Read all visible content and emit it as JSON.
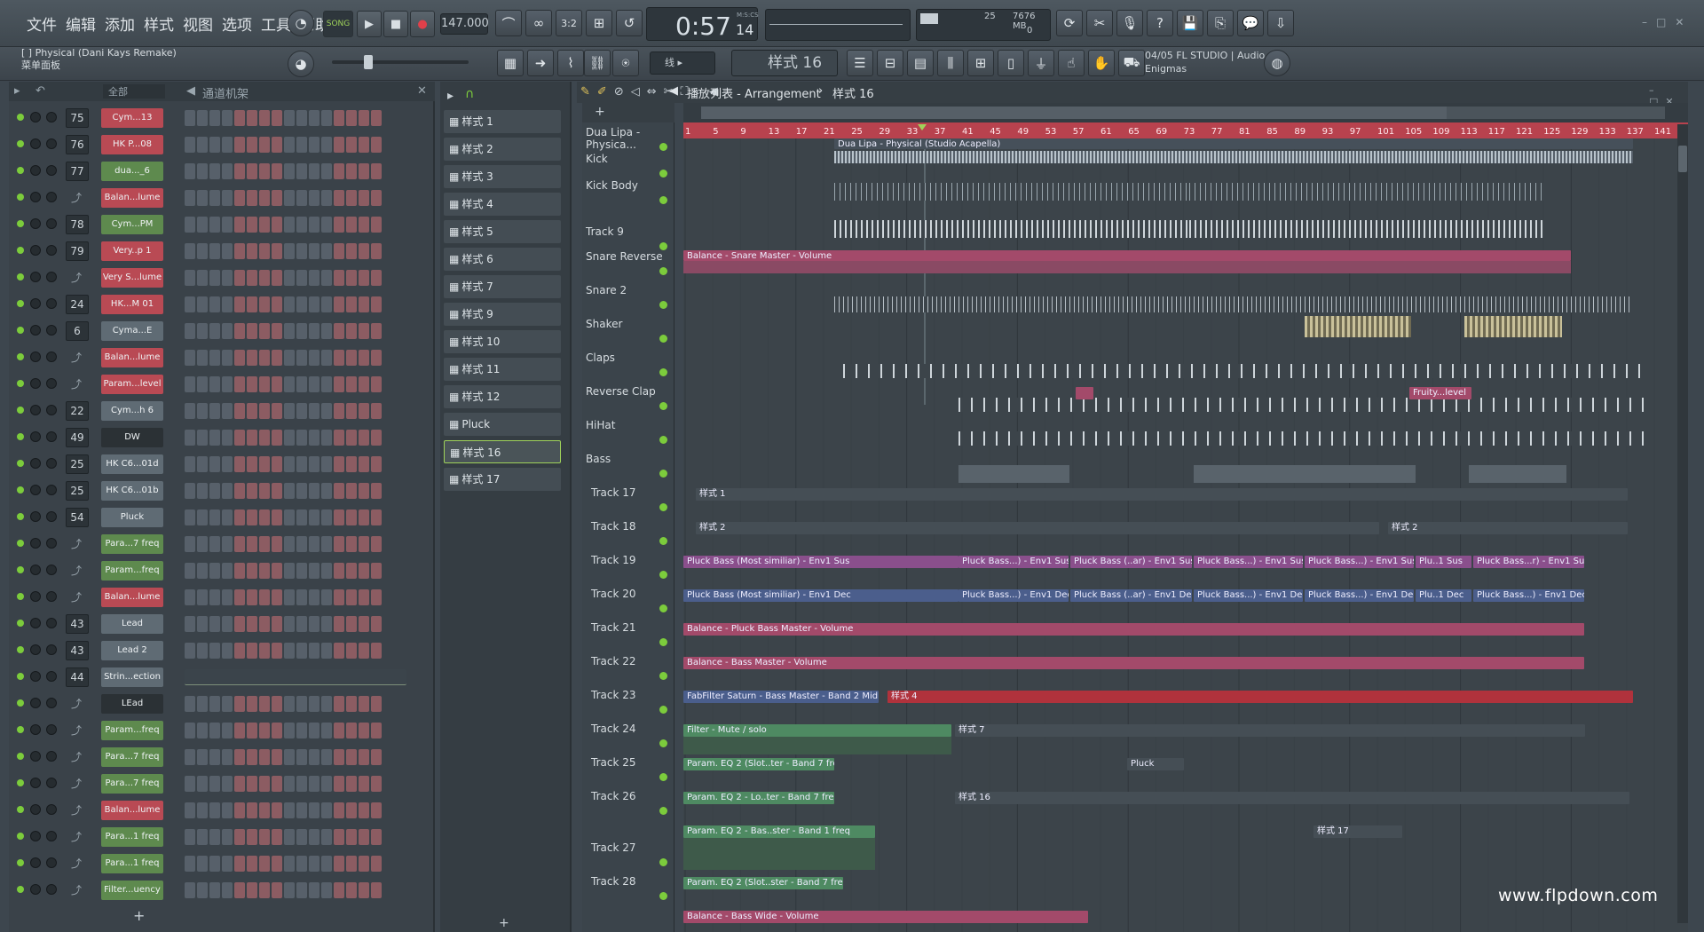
{
  "menu": [
    "文件",
    "编辑",
    "添加",
    "样式",
    "视图",
    "选项",
    "工具",
    "帮助"
  ],
  "hint": {
    "line1": "[  ] Physical (Dani Kays Remake)",
    "line2": "菜单面板"
  },
  "transport": {
    "mode": "SONG",
    "tempo": "147.000",
    "time": "0:57",
    "time_sub": "14",
    "time_unit": "M:S:CS"
  },
  "meters": {
    "cpu": "25",
    "mem": "7676 MB",
    "poly": "0"
  },
  "pattern_selector": {
    "value": "样式 16",
    "snap": "线"
  },
  "info": {
    "line1": "04/05  FL STUDIO | Audio",
    "line2": "Enigmas"
  },
  "rack": {
    "filter": "全部",
    "title": "通道机架"
  },
  "channels": [
    {
      "num": "75",
      "name": "Cym...13",
      "color": "#b94a54"
    },
    {
      "num": "76",
      "name": "HK P...08",
      "color": "#b94a54"
    },
    {
      "num": "77",
      "name": "dua..._6",
      "color": "#5e8a4e"
    },
    {
      "num": "",
      "name": "Balan...lume",
      "color": "#b94a54"
    },
    {
      "num": "78",
      "name": "Cym...PM",
      "color": "#5e8a4e"
    },
    {
      "num": "79",
      "name": "Very..p 1",
      "color": "#b94a54"
    },
    {
      "num": "",
      "name": "Very S...lume",
      "color": "#b94a54"
    },
    {
      "num": "24",
      "name": "HK...M 01",
      "color": "#b94a54"
    },
    {
      "num": "6",
      "name": "Cyma...E",
      "color": "#5f6b74"
    },
    {
      "num": "",
      "name": "Balan...lume",
      "color": "#b94a54"
    },
    {
      "num": "",
      "name": "Param...level",
      "color": "#b94a54"
    },
    {
      "num": "22",
      "name": "Cym...h 6",
      "color": "#5f6b74"
    },
    {
      "num": "49",
      "name": "DW",
      "color": "#2b3135"
    },
    {
      "num": "25",
      "name": "HK C6...01d",
      "color": "#5f6b74"
    },
    {
      "num": "25",
      "name": "HK C6...01b",
      "color": "#5f6b74"
    },
    {
      "num": "54",
      "name": "Pluck",
      "color": "#5f6b74"
    },
    {
      "num": "",
      "name": "Para...7 freq",
      "color": "#5e8a4e"
    },
    {
      "num": "",
      "name": "Param...freq",
      "color": "#5e8a4e"
    },
    {
      "num": "",
      "name": "Balan...lume",
      "color": "#b94a54"
    },
    {
      "num": "43",
      "name": "Lead",
      "color": "#5f6b74"
    },
    {
      "num": "43",
      "name": "Lead 2",
      "color": "#5f6b74"
    },
    {
      "num": "44",
      "name": "Strin...ection",
      "color": "#5f6b74"
    },
    {
      "num": "",
      "name": "LEad",
      "color": "#2b3135"
    },
    {
      "num": "",
      "name": "Param...freq",
      "color": "#5e8a4e"
    },
    {
      "num": "",
      "name": "Para...7 freq",
      "color": "#5e8a4e"
    },
    {
      "num": "",
      "name": "Para...7 freq",
      "color": "#5e8a4e"
    },
    {
      "num": "",
      "name": "Balan...lume",
      "color": "#b94a54"
    },
    {
      "num": "",
      "name": "Para...1 freq",
      "color": "#5e8a4e"
    },
    {
      "num": "",
      "name": "Para...1 freq",
      "color": "#5e8a4e"
    },
    {
      "num": "",
      "name": "Filter...uency",
      "color": "#5e8a4e"
    }
  ],
  "patterns": [
    "样式 1",
    "样式 2",
    "样式 3",
    "样式 4",
    "样式 5",
    "样式 6",
    "样式 7",
    "样式 9",
    "样式 10",
    "样式 11",
    "样式 12",
    "Pluck",
    "样式 16",
    "样式 17"
  ],
  "playlist": {
    "title": "播放列表 - Arrangement",
    "crumb": "样式 16"
  },
  "bars": [
    "1",
    "5",
    "9",
    "13",
    "17",
    "21",
    "25",
    "29",
    "33",
    "37",
    "41",
    "45",
    "49",
    "53",
    "57",
    "61",
    "65",
    "69",
    "73",
    "77",
    "81",
    "85",
    "89",
    "93",
    "97",
    "101",
    "105",
    "109",
    "113",
    "117",
    "121",
    "125",
    "129",
    "133",
    "137",
    "141"
  ],
  "tracks": [
    "Dua Lipa - Physica...",
    "Kick",
    "Kick Body",
    "Track 9",
    "Snare Reverse",
    "Snare 2",
    "Shaker",
    "Claps",
    "Reverse Clap",
    "HiHat",
    "Bass",
    "Track 17",
    "Track 18",
    "Track 19",
    "Track 20",
    "Track 21",
    "Track 22",
    "Track 23",
    "Track 24",
    "Track 25",
    "Track 26",
    "Track 27",
    "Track 28"
  ],
  "clips": {
    "dua": "Dua Lipa - Physical (Studio Acapella)",
    "snare_master": "Balance - Snare Master - Volume",
    "fruity": "Fruity...level",
    "pat1": "样式 1",
    "pat2": "样式 2",
    "pat2b": "样式 2",
    "pluck_sus": "Pluck Bass (Most similiar) - Env1 Sus",
    "pluck_sus_short": [
      "Pluck Bass...) - Env1 Sus",
      "Pluck Bass (..ar) - Env1 Sus",
      "Pluck Bass...) - Env1 Sus",
      "Pluck Bass...) - Env1 Sus",
      "Plu..1 Sus",
      "Pluck Bass...r) - Env1 Sus"
    ],
    "pluck_dec": "Pluck Bass (Most similiar) - Env1 Dec",
    "pluck_dec_short": [
      "Pluck Bass...) - Env1 Dec",
      "Pluck Bass (..ar) - Env1 Dec",
      "Pluck Bass...) - Env1 Dec",
      "Pluck Bass...) - Env1 Dec",
      "Plu..1 Dec",
      "Pluck Bass...) - Env1 Dec"
    ],
    "pluck_master": "Balance - Pluck Bass Master - Volume",
    "bass_master": "Balance - Bass Master - Volume",
    "fabfilter": "FabFilter Saturn - Bass Master - Band 2 Mid",
    "pat4": "样式 4",
    "filter": "Filter - Mute / solo",
    "pat7": "样式 7",
    "eq1": "Param. EQ 2 (Slot..ter - Band 7 freq",
    "pluck": "Pluck",
    "eq2": "Param. EQ 2 - Lo..ter - Band 7 freq",
    "pat16": "样式 16",
    "eq3": "Param. EQ 2 - Bas..ster - Band 1 freq",
    "pat17": "样式 17",
    "eq4": "Param. EQ 2 (Slot..ster - Band 7 freq",
    "bass_wide": "Balance - Bass Wide - Volume"
  },
  "watermark": "www.flpdown.com",
  "colors": {
    "accent": "#b8424e",
    "green": "#7ccc3c",
    "pluck_sus": "#8a4f8c",
    "pluck_dec": "#4b5e8c",
    "balance": "#a34a6a",
    "eq": "#4e8a62",
    "pat4": "#b0323c"
  }
}
